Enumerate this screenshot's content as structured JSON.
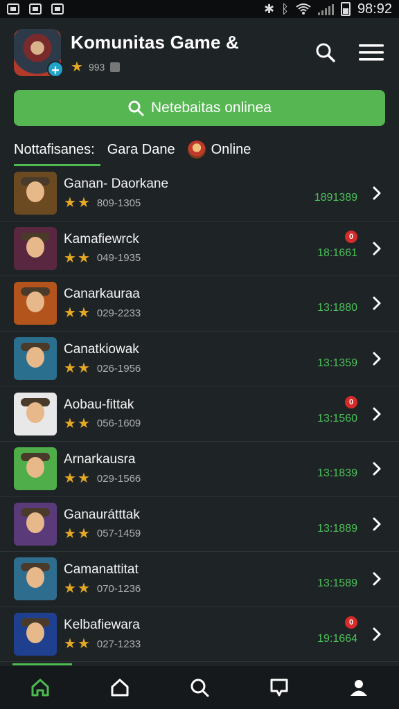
{
  "status_bar": {
    "time": "98:92",
    "icons": [
      "bug-icon",
      "bluetooth-icon",
      "wifi-icon",
      "signal-icon",
      "battery-icon"
    ]
  },
  "header": {
    "title": "Komunitas Game &",
    "rating_text": "993",
    "icons": [
      "app-logo",
      "search-icon",
      "menu-icon"
    ]
  },
  "banner": {
    "label": "Netebaitas onlinea",
    "icon": "search-icon",
    "color": "#56b752"
  },
  "tabs": [
    {
      "label": "Nottafisanes:",
      "active": true
    },
    {
      "label": "Gara Dane",
      "active": false
    },
    {
      "label": "Online",
      "active": false,
      "icon": "avatar"
    }
  ],
  "items": [
    {
      "title": "Ganan- Daorkane",
      "code": "809-1305",
      "time": "1891389",
      "badge": "",
      "bg": "#6b4a22"
    },
    {
      "title": "Kamafiewrck",
      "code": "049-1935",
      "time": "18:1661",
      "badge": "0",
      "bg": "#5a2740"
    },
    {
      "title": "Canarkauraa",
      "code": "029-2233",
      "time": "13:1880",
      "badge": "",
      "bg": "#b4541d"
    },
    {
      "title": "Canatkiowak",
      "code": "026-1956",
      "time": "13:1359",
      "badge": "",
      "bg": "#2b6f8f"
    },
    {
      "title": "Aobau-fittak",
      "code": "056-1609",
      "time": "13:1560",
      "badge": "0",
      "bg": "#e8e8e8"
    },
    {
      "title": "Arnarkausra",
      "code": "029-1566",
      "time": "13:1839",
      "badge": "",
      "bg": "#4fae4a"
    },
    {
      "title": "Ganaurátttak",
      "code": "057-1459",
      "time": "13:1889",
      "badge": "",
      "bg": "#5b3a7a"
    },
    {
      "title": "Camanattitat",
      "code": "070-1236",
      "time": "13:1589",
      "badge": "",
      "bg": "#2f6d8f"
    },
    {
      "title": "Kelbafiewara",
      "code": "027-1233",
      "time": "19:1664",
      "badge": "0",
      "bg": "#1f3f8f"
    }
  ],
  "bottom_nav": [
    {
      "name": "home",
      "icon": "home-icon",
      "active": true
    },
    {
      "name": "house",
      "icon": "house-icon",
      "active": false
    },
    {
      "name": "search",
      "icon": "search-icon",
      "active": false
    },
    {
      "name": "chat",
      "icon": "chat-icon",
      "active": false
    },
    {
      "name": "profile",
      "icon": "person-icon",
      "active": false
    }
  ],
  "colors": {
    "accent": "#4cbb4f",
    "time_green": "#4cc15a",
    "badge_red": "#d62b2b",
    "star": "#e5a823"
  }
}
